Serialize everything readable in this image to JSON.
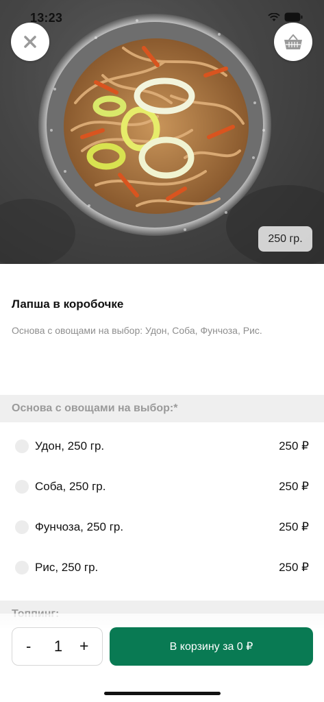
{
  "status_bar": {
    "time": "13:23"
  },
  "hero": {
    "weight_badge": "250 гр."
  },
  "product": {
    "title": "Лапша в коробочке",
    "description": "Основа с овощами на выбор: Удон, Соба, Фунчоза, Рис."
  },
  "sections": [
    {
      "header": "Основа с овощами на выбор:*",
      "options": [
        {
          "label": "Удон, 250 гр.",
          "price": "250 ₽",
          "selected": false
        },
        {
          "label": "Соба, 250 гр.",
          "price": "250 ₽",
          "selected": false
        },
        {
          "label": "Фунчоза, 250 гр.",
          "price": "250 ₽",
          "selected": false
        },
        {
          "label": "Рис, 250 гр.",
          "price": "250 ₽",
          "selected": false
        }
      ]
    },
    {
      "header": "Топпинг:"
    }
  ],
  "footer": {
    "minus": "-",
    "quantity": "1",
    "plus": "+",
    "cart_button": "В корзину за 0 ₽"
  },
  "colors": {
    "accent": "#097a53",
    "section_bg": "#efefef",
    "muted_text": "#8e8e8e"
  },
  "icons": {
    "close": "close-icon",
    "basket": "basket-icon"
  }
}
